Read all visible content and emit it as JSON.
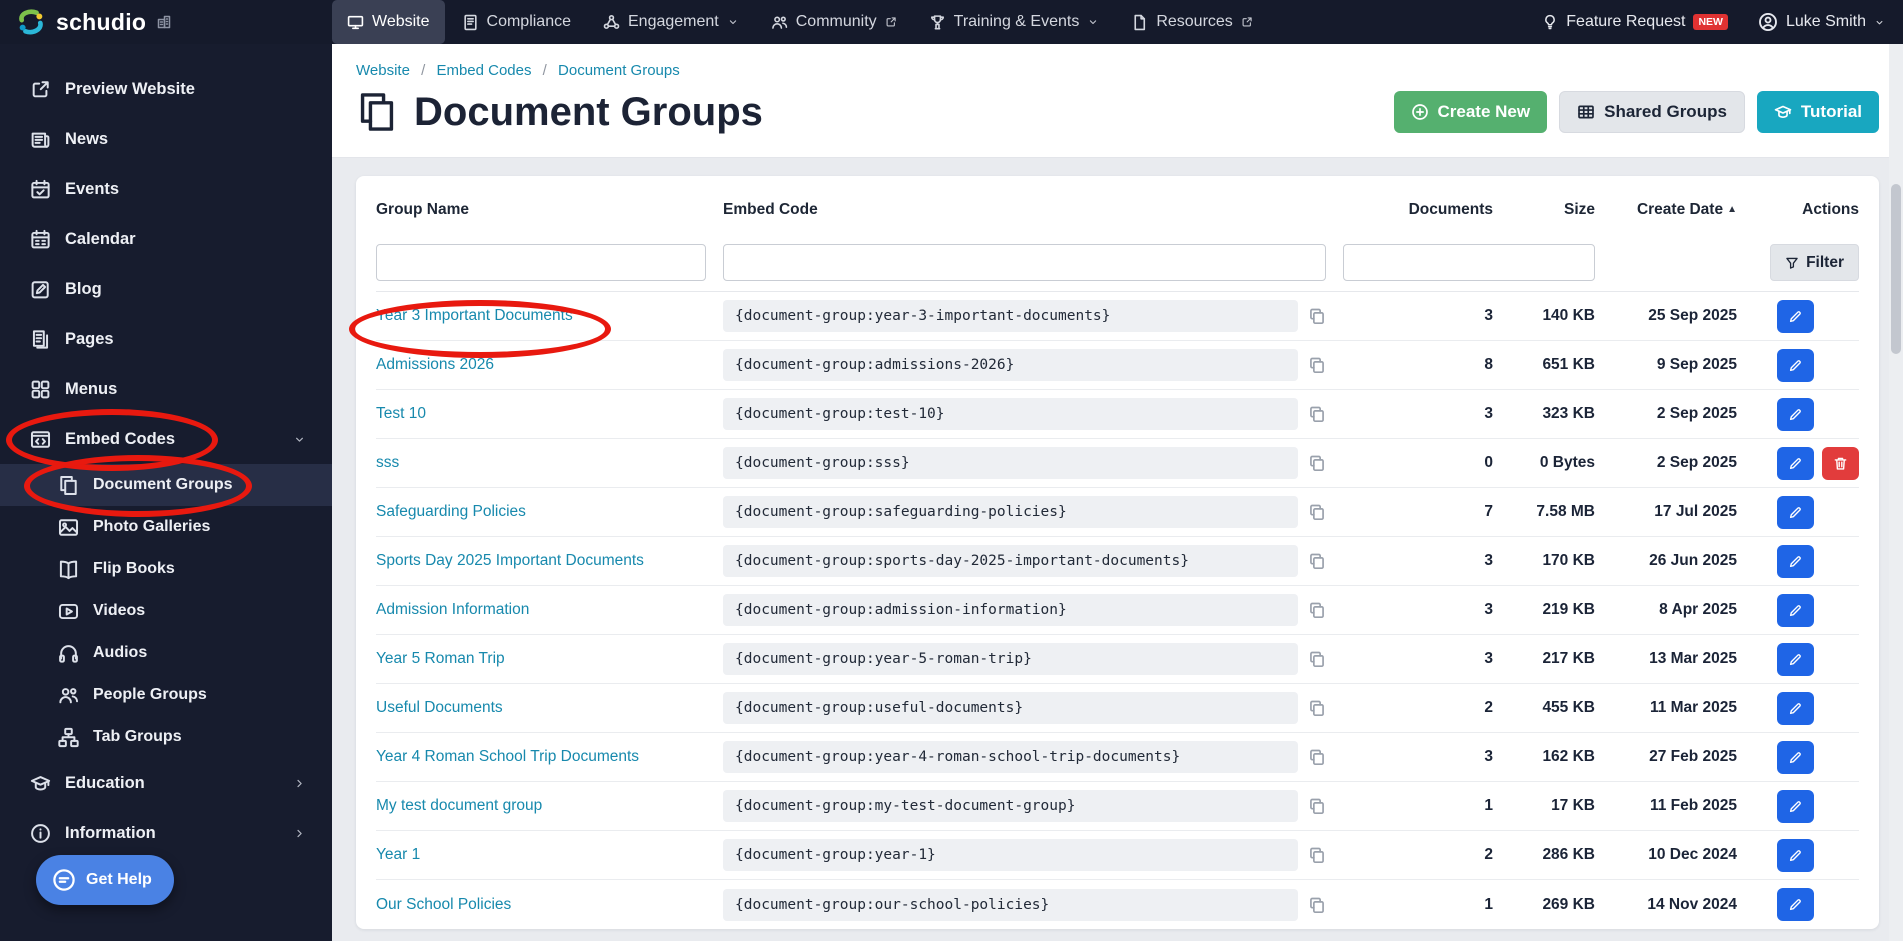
{
  "topbar": {
    "brand": "schudio",
    "nav": [
      {
        "label": "Website",
        "icon": "monitor-icon",
        "active": true
      },
      {
        "label": "Compliance",
        "icon": "compliance-icon"
      },
      {
        "label": "Engagement",
        "icon": "engagement-icon",
        "chevron": true
      },
      {
        "label": "Community",
        "icon": "community-icon",
        "external": true
      },
      {
        "label": "Training & Events",
        "icon": "training-icon",
        "chevron": true
      },
      {
        "label": "Resources",
        "icon": "resources-icon",
        "external": true
      }
    ],
    "feature_request_label": "Feature Request",
    "new_badge": "NEW",
    "user_name": "Luke Smith"
  },
  "sidebar": {
    "items": [
      {
        "label": "Preview Website",
        "icon": "external-link-icon",
        "type": "top",
        "color": "#d9dde6"
      },
      {
        "label": "News",
        "icon": "news-icon",
        "type": "top",
        "color": "#e2a23e"
      },
      {
        "label": "Events",
        "icon": "events-icon",
        "type": "top",
        "color": "#d9ce3f"
      },
      {
        "label": "Calendar",
        "icon": "calendar-icon",
        "type": "top",
        "color": "#e25c5c"
      },
      {
        "label": "Blog",
        "icon": "blog-icon",
        "type": "top",
        "color": "#35bdd6"
      },
      {
        "label": "Pages",
        "icon": "pages-icon",
        "type": "top",
        "color": "#e2a23e"
      },
      {
        "label": "Menus",
        "icon": "menus-icon",
        "type": "top",
        "color": "#d9dde6"
      },
      {
        "label": "Embed Codes",
        "icon": "embed-codes-icon",
        "type": "top",
        "color": "#e2a23e",
        "chevron": "down"
      },
      {
        "label": "Document Groups",
        "icon": "document-groups-icon",
        "type": "sub",
        "active": true,
        "color": "#f2f4f8"
      },
      {
        "label": "Photo Galleries",
        "icon": "photo-galleries-icon",
        "type": "sub",
        "color": "#e6e9f0"
      },
      {
        "label": "Flip Books",
        "icon": "flip-books-icon",
        "type": "sub",
        "color": "#e6e9f0"
      },
      {
        "label": "Videos",
        "icon": "videos-icon",
        "type": "sub",
        "color": "#e6e9f0"
      },
      {
        "label": "Audios",
        "icon": "audios-icon",
        "type": "sub",
        "color": "#e6e9f0"
      },
      {
        "label": "People Groups",
        "icon": "people-groups-icon",
        "type": "sub",
        "color": "#e6e9f0"
      },
      {
        "label": "Tab Groups",
        "icon": "tab-groups-icon",
        "type": "sub",
        "color": "#e6e9f0"
      },
      {
        "label": "Education",
        "icon": "education-icon",
        "type": "top",
        "color": "#35bdd6",
        "chevron": "right"
      },
      {
        "label": "Information",
        "icon": "information-icon",
        "type": "top",
        "color": "#e2a23e",
        "chevron": "right"
      }
    ],
    "get_help_label": "Get Help"
  },
  "breadcrumb": {
    "items": [
      "Website",
      "Embed Codes",
      "Document Groups"
    ],
    "separator": "/"
  },
  "page": {
    "title": "Document Groups"
  },
  "actions": {
    "create_new": "Create New",
    "shared_groups": "Shared Groups",
    "tutorial": "Tutorial"
  },
  "table": {
    "headers": {
      "group_name": "Group Name",
      "embed_code": "Embed Code",
      "documents": "Documents",
      "size": "Size",
      "create_date": "Create Date",
      "actions": "Actions"
    },
    "sort_indicator": "▲",
    "sort": {
      "column": "create_date",
      "direction": "asc"
    },
    "filter_button": "Filter",
    "filters": {
      "group_name": "",
      "embed_code": "",
      "documents": ""
    },
    "rows": [
      {
        "name": "Year 3 Important Documents",
        "code": "{document-group:year-3-important-documents}",
        "documents": "3",
        "size": "140 KB",
        "date": "25 Sep 2025",
        "deletable": false
      },
      {
        "name": "Admissions 2026",
        "code": "{document-group:admissions-2026}",
        "documents": "8",
        "size": "651 KB",
        "date": "9 Sep 2025",
        "deletable": false
      },
      {
        "name": "Test 10",
        "code": "{document-group:test-10}",
        "documents": "3",
        "size": "323 KB",
        "date": "2 Sep 2025",
        "deletable": false
      },
      {
        "name": "sss",
        "code": "{document-group:sss}",
        "documents": "0",
        "size": "0 Bytes",
        "date": "2 Sep 2025",
        "deletable": true
      },
      {
        "name": "Safeguarding Policies",
        "code": "{document-group:safeguarding-policies}",
        "documents": "7",
        "size": "7.58 MB",
        "date": "17 Jul 2025",
        "deletable": false
      },
      {
        "name": "Sports Day 2025 Important Documents",
        "code": "{document-group:sports-day-2025-important-documents}",
        "documents": "3",
        "size": "170 KB",
        "date": "26 Jun 2025",
        "deletable": false
      },
      {
        "name": "Admission Information",
        "code": "{document-group:admission-information}",
        "documents": "3",
        "size": "219 KB",
        "date": "8 Apr 2025",
        "deletable": false
      },
      {
        "name": "Year 5 Roman Trip",
        "code": "{document-group:year-5-roman-trip}",
        "documents": "3",
        "size": "217 KB",
        "date": "13 Mar 2025",
        "deletable": false
      },
      {
        "name": "Useful Documents",
        "code": "{document-group:useful-documents}",
        "documents": "2",
        "size": "455 KB",
        "date": "11 Mar 2025",
        "deletable": false
      },
      {
        "name": "Year 4 Roman School Trip Documents",
        "code": "{document-group:year-4-roman-school-trip-documents}",
        "documents": "3",
        "size": "162 KB",
        "date": "27 Feb 2025",
        "deletable": false
      },
      {
        "name": "My test document group",
        "code": "{document-group:my-test-document-group}",
        "documents": "1",
        "size": "17 KB",
        "date": "11 Feb 2025",
        "deletable": false
      },
      {
        "name": "Year 1",
        "code": "{document-group:year-1}",
        "documents": "2",
        "size": "286 KB",
        "date": "10 Dec 2024",
        "deletable": false
      },
      {
        "name": "Our School Policies",
        "code": "{document-group:our-school-policies}",
        "documents": "1",
        "size": "269 KB",
        "date": "14 Nov 2024",
        "deletable": false
      }
    ]
  },
  "colors": {
    "topbar_bg": "#151a2b",
    "sidebar_bg": "#171c2e",
    "link_teal": "#1789ad",
    "create_new_green": "#55b06f",
    "tutorial_teal": "#18a7c0",
    "edit_blue": "#1f65e6",
    "delete_red": "#e23c3c",
    "new_badge_red": "#e03232",
    "get_help_blue": "#4a82e4",
    "annotation_red": "#e8190f"
  }
}
